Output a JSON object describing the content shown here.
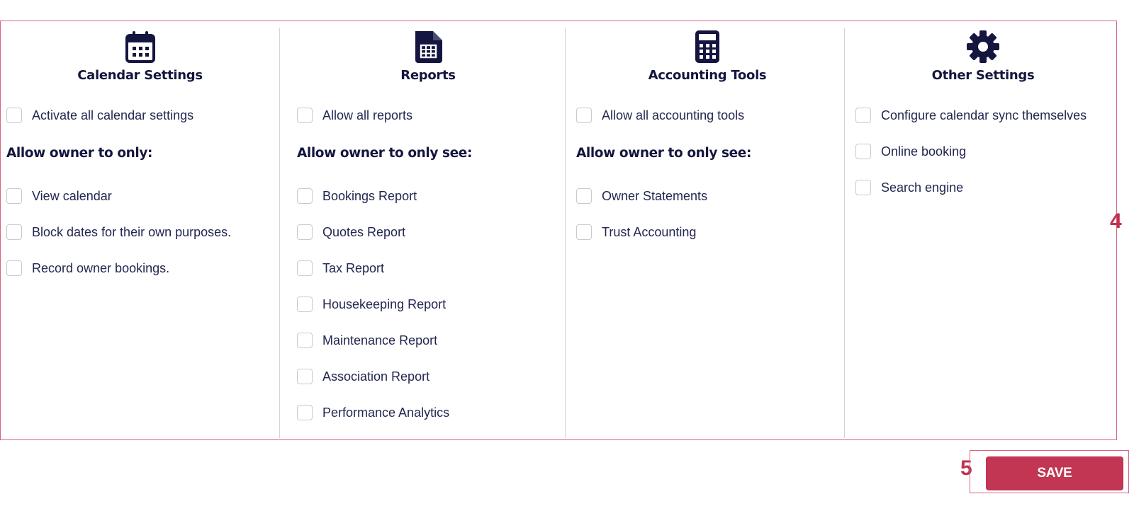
{
  "columns": [
    {
      "title": "Calendar Settings",
      "icon": "calendar-icon",
      "all_option": "Activate all calendar settings",
      "subheading": "Allow owner to only:",
      "options": [
        "View calendar",
        "Block dates for their own purposes.",
        "Record owner bookings."
      ]
    },
    {
      "title": "Reports",
      "icon": "report-file-icon",
      "all_option": "Allow all reports",
      "subheading": "Allow owner to only see:",
      "options": [
        "Bookings Report",
        "Quotes Report",
        "Tax Report",
        "Housekeeping Report",
        "Maintenance Report",
        "Association Report",
        "Performance Analytics"
      ]
    },
    {
      "title": "Accounting Tools",
      "icon": "calculator-icon",
      "all_option": "Allow all accounting tools",
      "subheading": "Allow owner to only see:",
      "options": [
        "Owner Statements",
        "Trust Accounting"
      ]
    },
    {
      "title": "Other Settings",
      "icon": "gear-icon",
      "options": [
        "Configure calendar sync themselves",
        "Online booking",
        "Search engine"
      ]
    }
  ],
  "annotations": {
    "panel_marker": "4",
    "save_marker": "5"
  },
  "save_label": "SAVE",
  "colors": {
    "accent": "#c23553",
    "heading": "#14163f",
    "text": "#23264f",
    "border": "#d9627e"
  }
}
